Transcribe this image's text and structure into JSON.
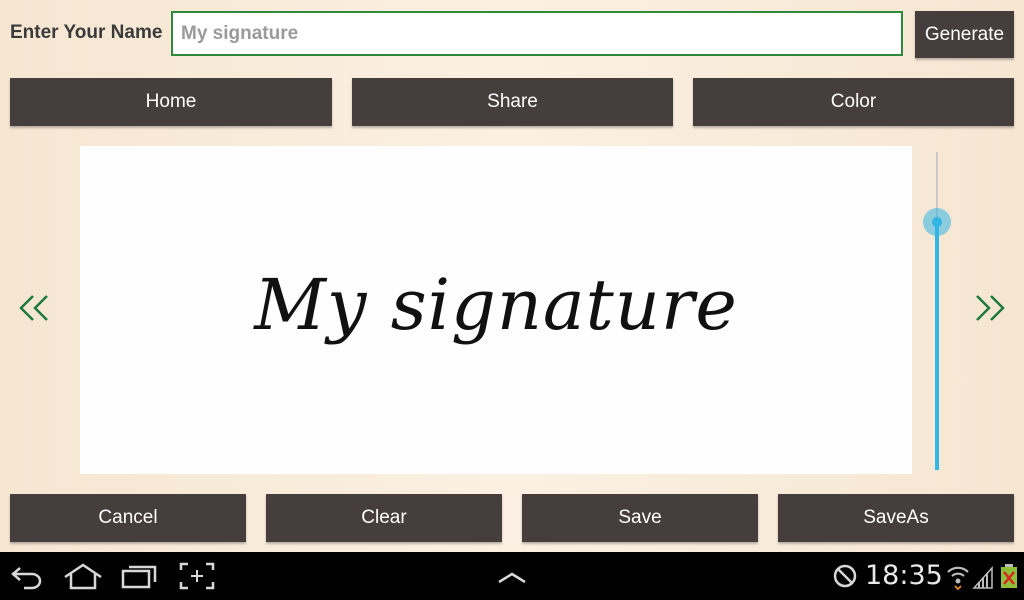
{
  "header": {
    "name_label": "Enter Your Name",
    "name_value": "",
    "name_placeholder": "My signature",
    "generate_label": "Generate"
  },
  "nav": {
    "home_label": "Home",
    "share_label": "Share",
    "color_label": "Color"
  },
  "canvas": {
    "signature_text": "My signature"
  },
  "size_slider": {
    "level": 0.78
  },
  "actions": {
    "cancel_label": "Cancel",
    "clear_label": "Clear",
    "save_label": "Save",
    "saveas_label": "SaveAs"
  },
  "system_bar": {
    "time": "18:35"
  },
  "colors": {
    "button_bg": "#463d3d",
    "input_border": "#2e8b3c",
    "arrow_green": "#1e7a3c",
    "slider_accent": "#33b5e5",
    "background": "#f8ead9"
  },
  "icons": [
    "back-icon",
    "home-icon",
    "recent-apps-icon",
    "screenshot-icon",
    "up-chevron-icon",
    "sync-disabled-icon",
    "wifi-icon",
    "signal-icon",
    "battery-icon",
    "prev-double-chevron-icon",
    "next-double-chevron-icon"
  ]
}
